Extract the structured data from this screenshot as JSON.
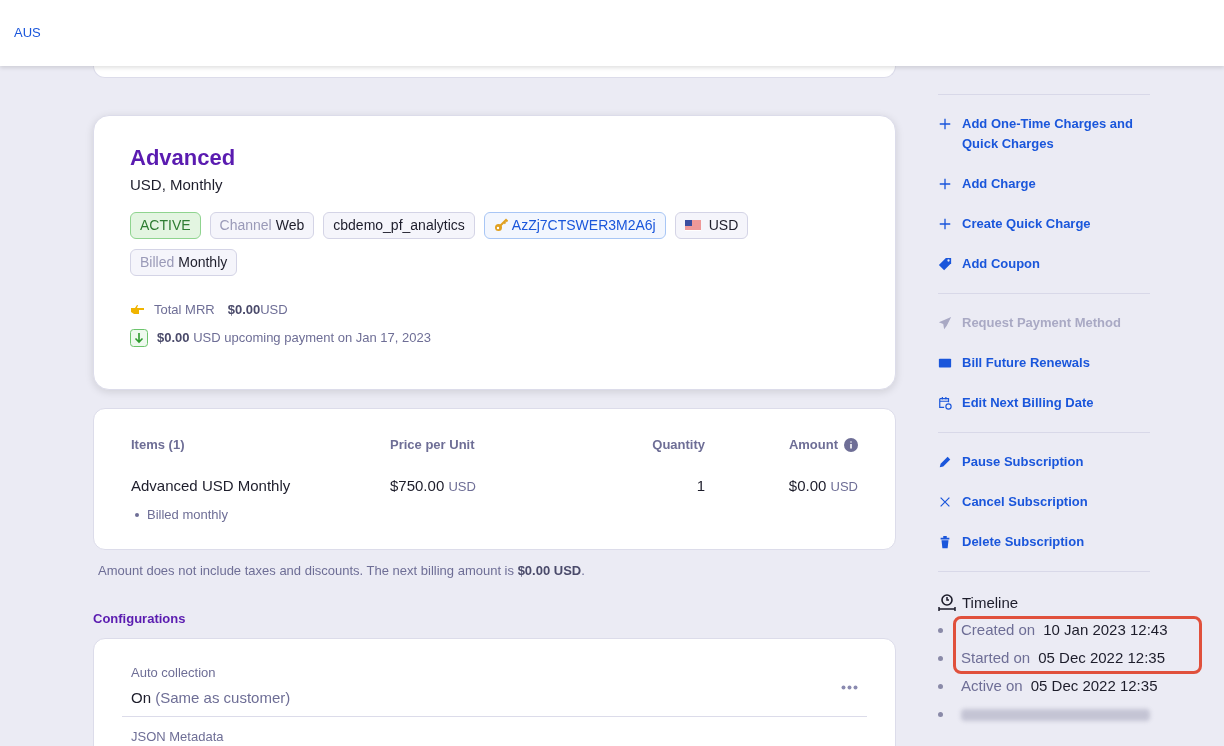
{
  "header": {
    "region": "AUS"
  },
  "plan": {
    "name": "Advanced",
    "subtitle": "USD, Monthly",
    "tags": [
      {
        "kind": "status",
        "value": "ACTIVE"
      },
      {
        "kind": "labeled",
        "label": "Channel",
        "value": "Web"
      },
      {
        "kind": "plain",
        "value": "cbdemo_pf_analytics"
      },
      {
        "kind": "key",
        "value": "AzZj7CTSWER3M2A6j"
      },
      {
        "kind": "flag",
        "value": "USD"
      },
      {
        "kind": "labeled",
        "label": "Billed",
        "value": "Monthly"
      }
    ],
    "mrr": {
      "label": "Total MRR",
      "amount": "$0.00",
      "currency": "USD"
    },
    "upcoming": {
      "amount": "$0.00",
      "text": "USD upcoming payment on Jan 17, 2023"
    }
  },
  "items_table": {
    "columns": [
      "Items (1)",
      "Price per Unit",
      "Quantity",
      "Amount"
    ],
    "rows": [
      {
        "name": "Advanced USD Monthly",
        "note": "Billed monthly",
        "price": "$750.00",
        "price_currency": "USD",
        "quantity": "1",
        "amount": "$0.00",
        "amount_currency": "USD"
      }
    ]
  },
  "footnote": "Amount does not include taxes and discounts. The next billing amount is **$0.00 USD**.",
  "configurations": {
    "title": "Configurations",
    "fields": [
      {
        "label": "Auto collection",
        "value": "On",
        "detail": "(Same as customer)"
      },
      {
        "label": "JSON Metadata"
      }
    ]
  },
  "actions": [
    [
      {
        "kind": "plus",
        "label": "Add One-Time Charges and Quick Charges",
        "disabled": false
      },
      {
        "kind": "plus",
        "label": "Add Charge",
        "disabled": false
      },
      {
        "kind": "plus",
        "label": "Create Quick Charge",
        "disabled": false
      },
      {
        "kind": "tag",
        "label": "Add Coupon",
        "disabled": false
      }
    ],
    [
      {
        "kind": "send",
        "label": "Request Payment Method",
        "disabled": true
      },
      {
        "kind": "card",
        "label": "Bill Future Renewals",
        "disabled": false
      },
      {
        "kind": "calendar",
        "label": "Edit Next Billing Date",
        "disabled": false
      }
    ],
    [
      {
        "kind": "pencil",
        "label": "Pause Subscription",
        "disabled": false
      },
      {
        "kind": "x",
        "label": "Cancel Subscription",
        "disabled": false
      },
      {
        "kind": "trash",
        "label": "Delete Subscription",
        "disabled": false
      }
    ]
  ],
  "timeline": {
    "title": "Timeline",
    "events": [
      {
        "kind": "event",
        "label": "Created on",
        "date": "10 Jan 2023 12:43",
        "highlighted": true
      },
      {
        "kind": "event",
        "label": "Started on",
        "date": "05 Dec 2022 12:35",
        "highlighted": true
      },
      {
        "kind": "event",
        "label": "Active on",
        "date": "05 Dec 2022 12:35",
        "highlighted": false
      },
      {
        "kind": "redacted",
        "highlighted": false
      }
    ]
  }
}
